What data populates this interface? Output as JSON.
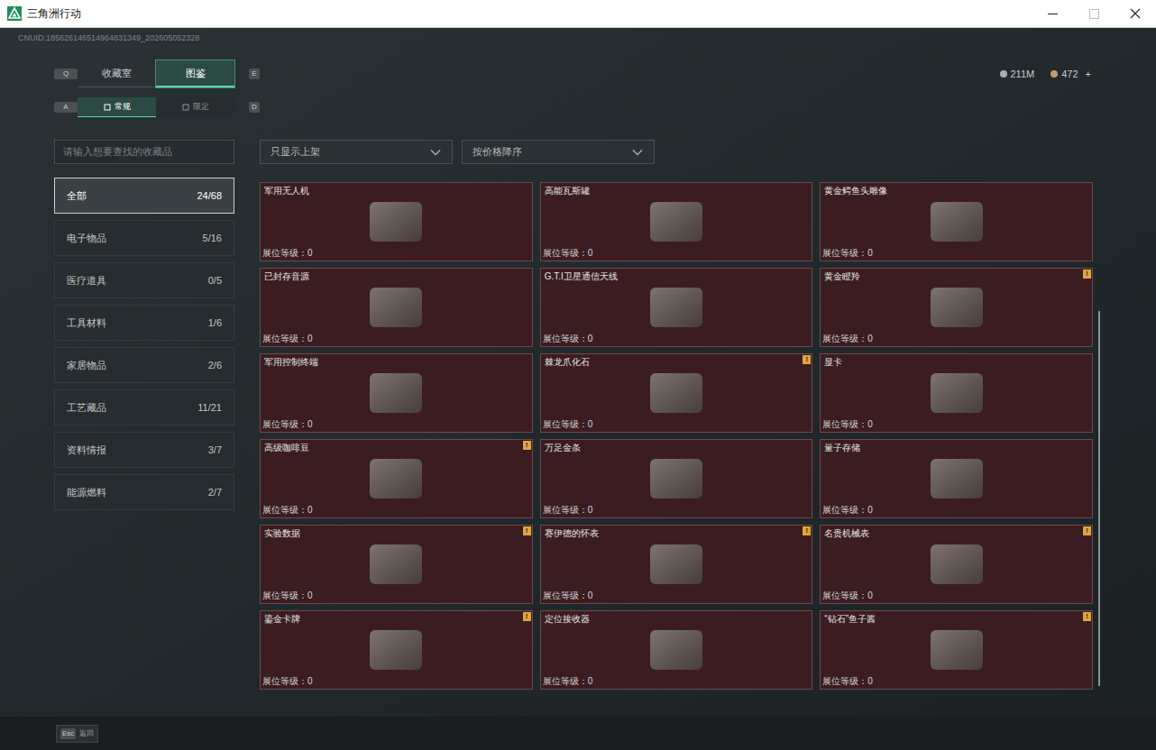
{
  "window": {
    "title": "三角洲行动",
    "account_id": "CNUID:185626146514964831349_202605052328"
  },
  "currency": [
    {
      "value": "211M",
      "plus": ""
    },
    {
      "value": "472",
      "plus": "+"
    }
  ],
  "tabs": {
    "key_left": "Q",
    "key_right": "E",
    "items": [
      {
        "label": "收藏室",
        "selected": false
      },
      {
        "label": "图鉴",
        "selected": true
      }
    ]
  },
  "subtabs": {
    "key_left": "A",
    "key_right": "D",
    "items": [
      {
        "label": "常规",
        "selected": true
      },
      {
        "label": "限定",
        "selected": false
      }
    ]
  },
  "search": {
    "placeholder": "请输入想要查找的收藏品"
  },
  "filters": [
    "只显示上架",
    "按价格降序"
  ],
  "categories": [
    {
      "label": "全部",
      "count": "24/68",
      "selected": true
    },
    {
      "label": "电子物品",
      "count": "5/16",
      "selected": false
    },
    {
      "label": "医疗道具",
      "count": "0/5",
      "selected": false
    },
    {
      "label": "工具材料",
      "count": "1/6",
      "selected": false
    },
    {
      "label": "家居物品",
      "count": "2/6",
      "selected": false
    },
    {
      "label": "工艺藏品",
      "count": "11/21",
      "selected": false
    },
    {
      "label": "资料情报",
      "count": "3/7",
      "selected": false
    },
    {
      "label": "能源燃料",
      "count": "2/7",
      "selected": false
    }
  ],
  "alert_mark": "!",
  "items": [
    {
      "name": "军用无人机",
      "level": "展位等级：0",
      "alert": false
    },
    {
      "name": "高能瓦斯罐",
      "level": "展位等级：0",
      "alert": false
    },
    {
      "name": "黄金鳄鱼头雕像",
      "level": "展位等级：0",
      "alert": false
    },
    {
      "name": "已封存音源",
      "level": "展位等级：0",
      "alert": false
    },
    {
      "name": "G.T.I卫星通信天线",
      "level": "展位等级：0",
      "alert": false
    },
    {
      "name": "黄金瞪羚",
      "level": "展位等级：0",
      "alert": true
    },
    {
      "name": "军用控制终端",
      "level": "展位等级：0",
      "alert": false
    },
    {
      "name": "棘龙爪化石",
      "level": "展位等级：0",
      "alert": true
    },
    {
      "name": "显卡",
      "level": "展位等级：0",
      "alert": false
    },
    {
      "name": "高级咖啡豆",
      "level": "展位等级：0",
      "alert": true
    },
    {
      "name": "万足金条",
      "level": "展位等级：0",
      "alert": false
    },
    {
      "name": "量子存储",
      "level": "展位等级：0",
      "alert": false
    },
    {
      "name": "实验数据",
      "level": "展位等级：0",
      "alert": true
    },
    {
      "name": "赛伊德的怀表",
      "level": "展位等级：0",
      "alert": true
    },
    {
      "name": "名贵机械表",
      "level": "展位等级：0",
      "alert": true
    },
    {
      "name": "鎏金卡牌",
      "level": "展位等级：0",
      "alert": true
    },
    {
      "name": "定位接收器",
      "level": "展位等级：0",
      "alert": false
    },
    {
      "name": "“钻石”鱼子酱",
      "level": "展位等级：0",
      "alert": true
    }
  ],
  "footer": {
    "key": "Esc",
    "label": "返回"
  }
}
